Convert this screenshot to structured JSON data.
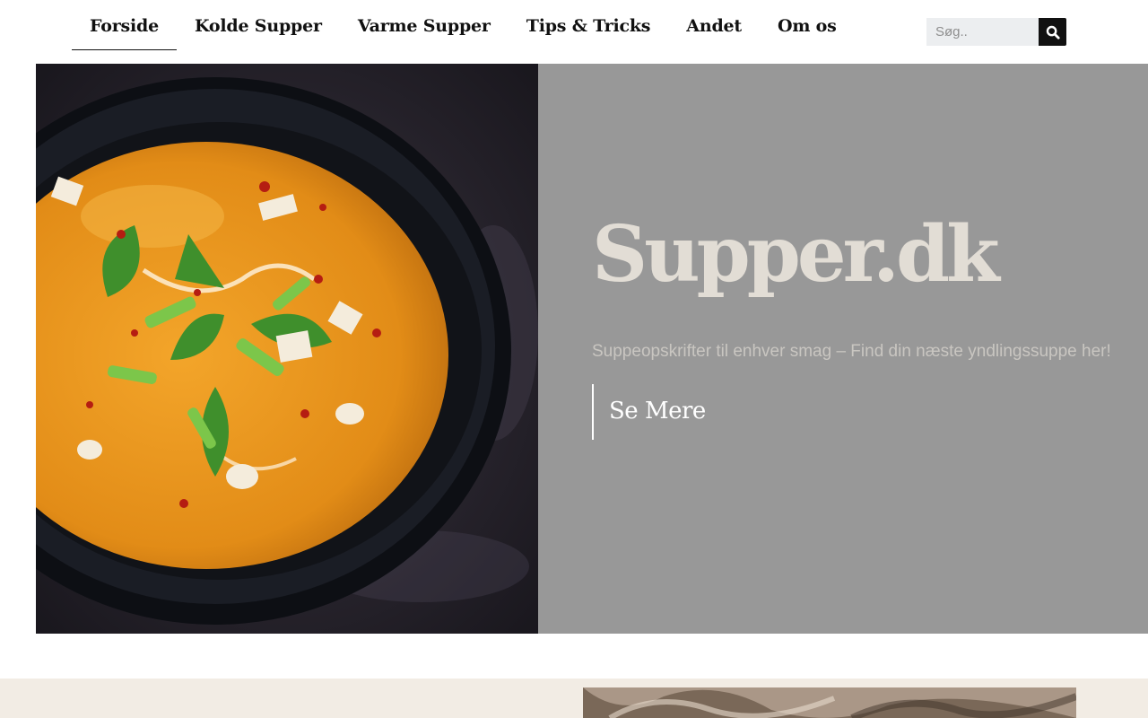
{
  "nav": {
    "items": [
      {
        "label": "Forside",
        "active": true
      },
      {
        "label": "Kolde Supper",
        "active": false
      },
      {
        "label": "Varme Supper",
        "active": false
      },
      {
        "label": "Tips & Tricks",
        "active": false
      },
      {
        "label": "Andet",
        "active": false
      },
      {
        "label": "Om os",
        "active": false
      }
    ]
  },
  "search": {
    "placeholder": "Søg..",
    "value": "",
    "icon": "search-icon"
  },
  "hero": {
    "title": "Supper.dk",
    "subtitle": "Suppeopskrifter til enhver smag – Find din næste yndlingssuppe her!",
    "cta_label": "Se Mere",
    "image_icon": "soup-bowl-photo"
  },
  "section2": {
    "image_icon": "kitchen-photo"
  },
  "colors": {
    "hero_bg": "#989898",
    "title": "#e2ddd5",
    "subtitle": "#c9c6c1",
    "cta_text": "#ffffff",
    "section2_bg": "#f2ece4",
    "search_button": "#111111"
  }
}
